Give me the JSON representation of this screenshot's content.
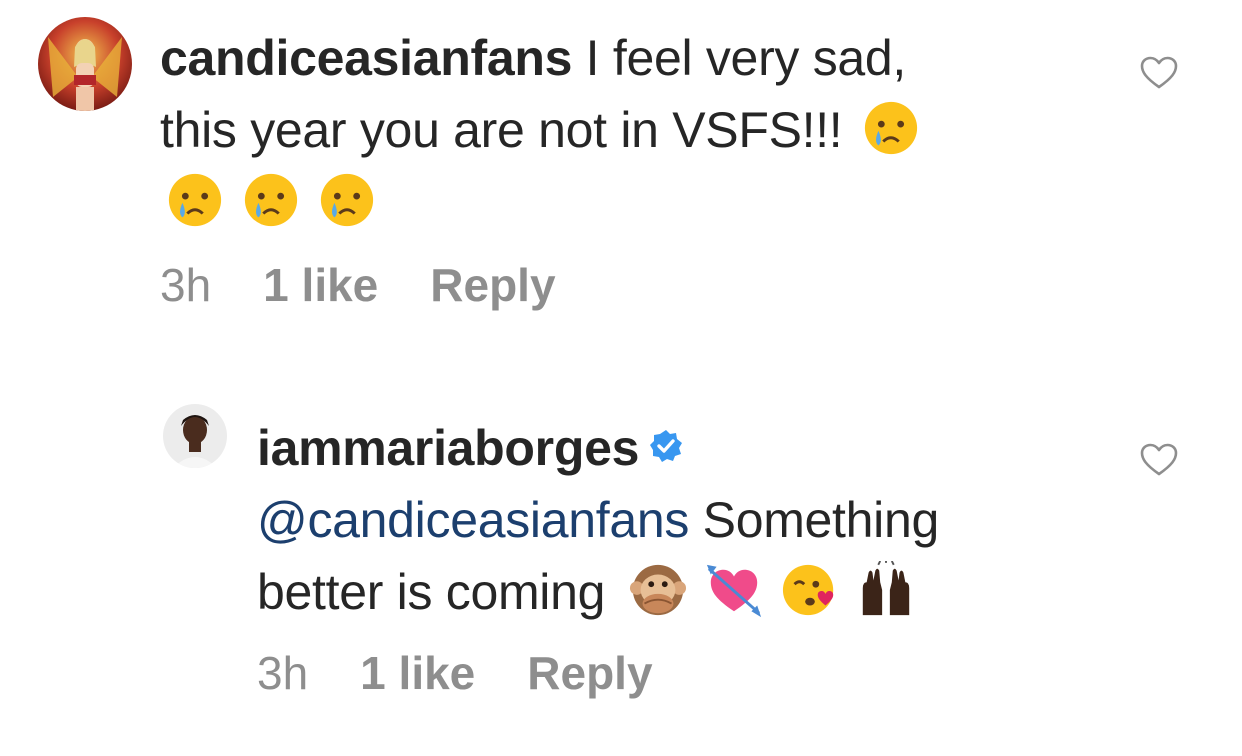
{
  "comments": [
    {
      "username": "candiceasianfans",
      "text_line1": " I feel very sad,",
      "text_line2": "this year you are not in VSFS!!!",
      "emojis": [
        "crying-face",
        "crying-face",
        "crying-face",
        "crying-face"
      ],
      "time": "3h",
      "likes": "1 like",
      "reply": "Reply"
    },
    {
      "username": "iammariaborges",
      "verified": true,
      "mention": "@candiceasianfans",
      "text_line1": " Something",
      "text_line2": "better is coming",
      "emojis": [
        "speak-no-evil-monkey",
        "heart-with-arrow",
        "face-blowing-kiss",
        "raising-hands-dark-skin"
      ],
      "time": "3h",
      "likes": "1 like",
      "reply": "Reply"
    }
  ],
  "colors": {
    "text": "#262626",
    "meta": "#8e8e8e",
    "mention": "#1c3f6e",
    "verified": "#3897f0"
  }
}
